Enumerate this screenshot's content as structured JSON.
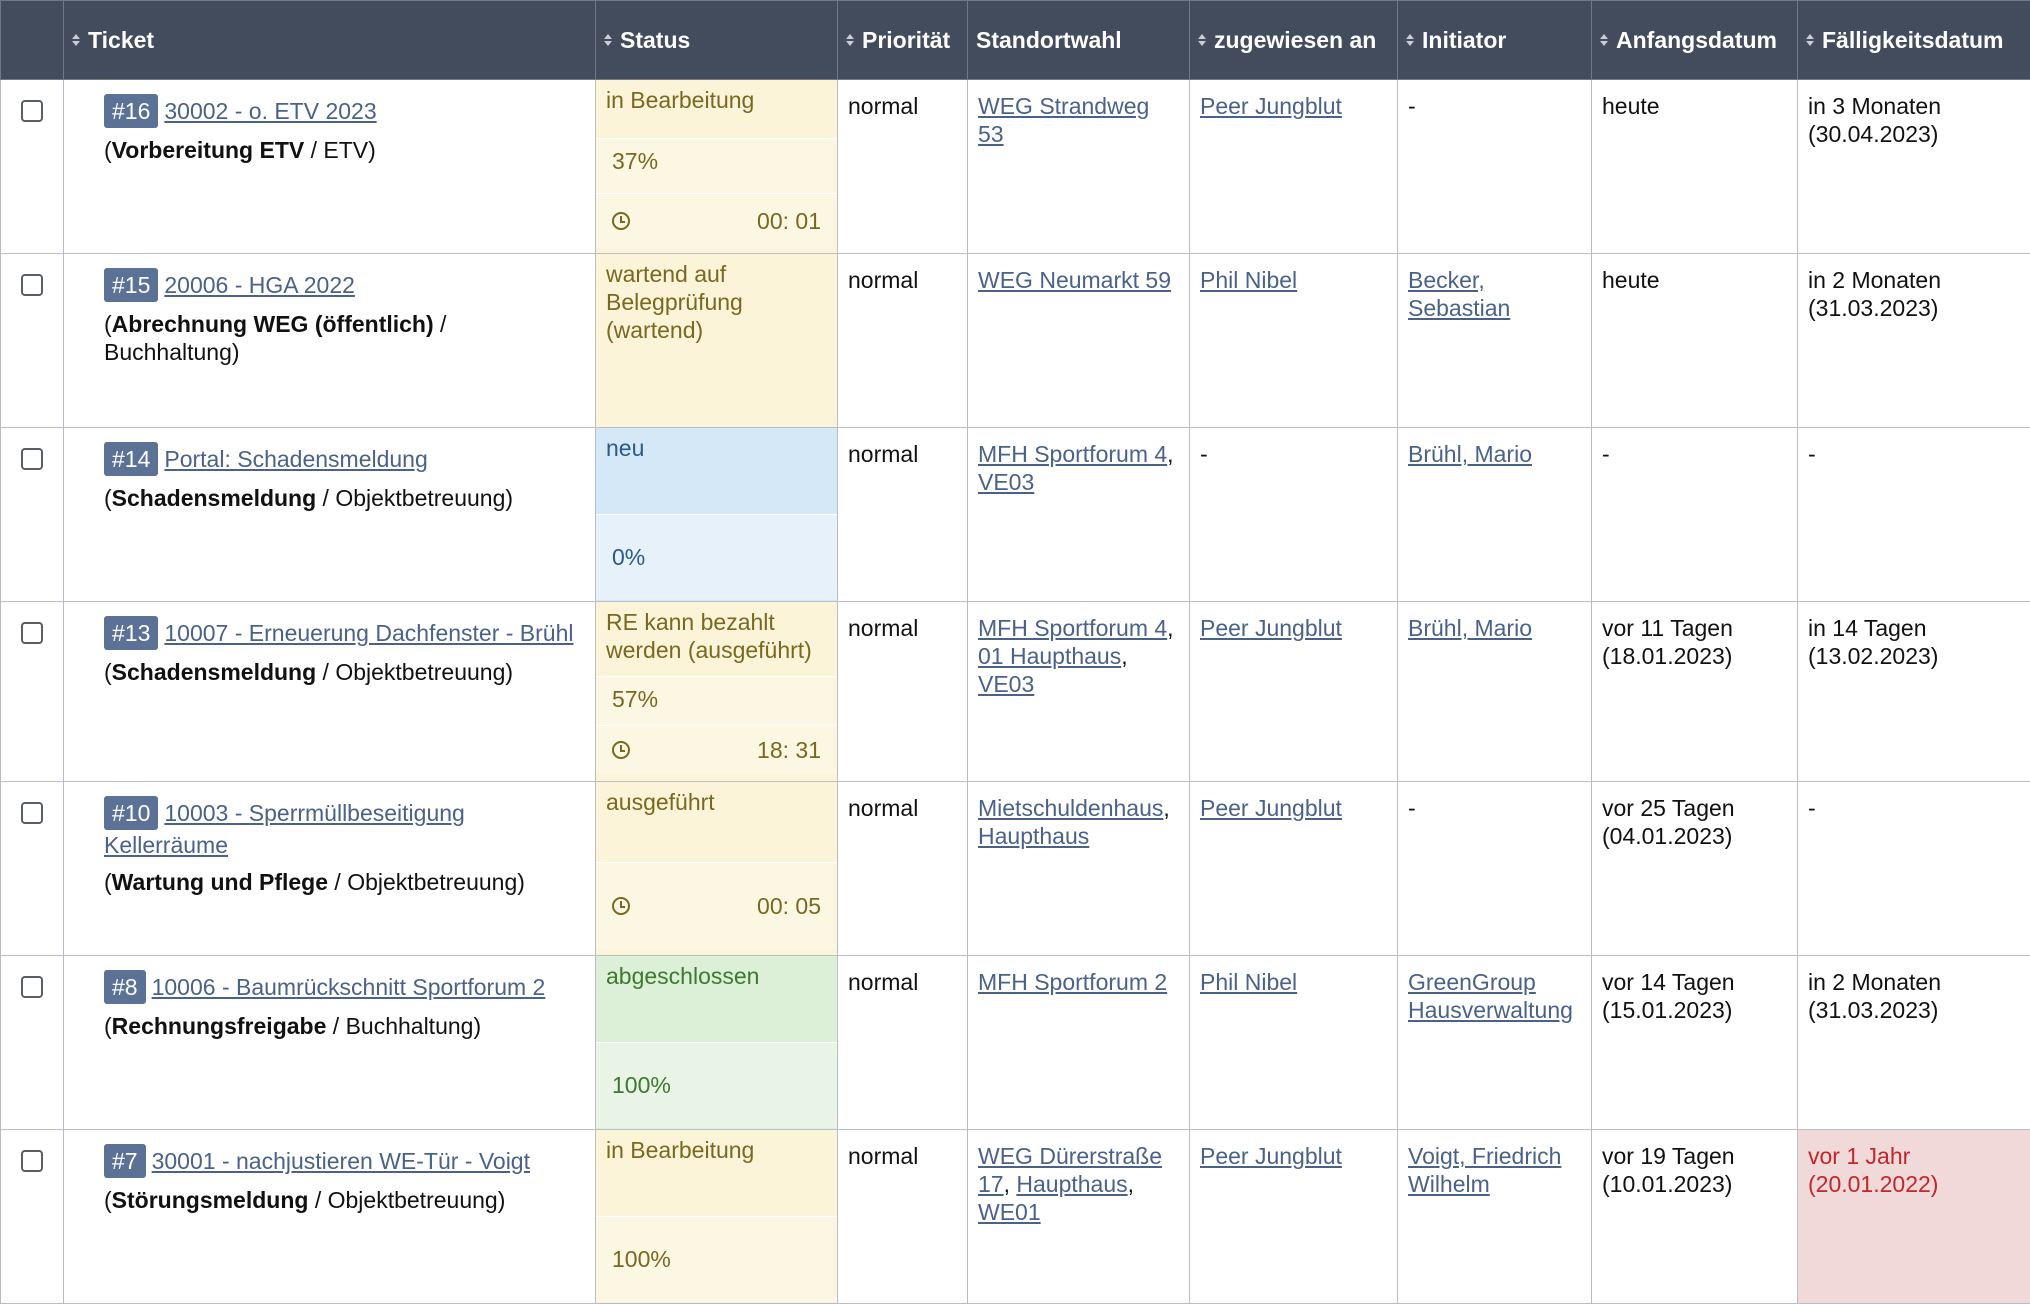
{
  "headers": {
    "ticket": "Ticket",
    "status": "Status",
    "priority": "Priorität",
    "location": "Standortwahl",
    "assigned": "zugewiesen an",
    "initiator": "Initiator",
    "start": "Anfangsdatum",
    "due": "Fälligkeitsdatum"
  },
  "rows": [
    {
      "id": "#16",
      "title": "30002 - o. ETV 2023",
      "category": "Vorbereitung ETV",
      "group": "ETV",
      "status": "in Bearbeitung",
      "progress": "37%",
      "time": "00: 01",
      "priority": "normal",
      "location": "WEG Strandweg 53",
      "assigned": "Peer Jungblut",
      "initiator": "-",
      "start": "heute",
      "due": "in 3 Monaten (30.04.2023)"
    },
    {
      "id": "#15",
      "title": "20006 - HGA 2022",
      "category": "Abrechnung WEG (öffentlich)",
      "group": "Buchhaltung",
      "status": "wartend auf Belegprüfung (wartend)",
      "priority": "normal",
      "location": "WEG Neumarkt 59",
      "assigned": "Phil Nibel",
      "initiator": "Becker, Sebastian",
      "start": "heute",
      "due": "in 2 Monaten (31.03.2023)"
    },
    {
      "id": "#14",
      "title": "Portal: Schadensmeldung",
      "category": "Schadensmeldung",
      "group": "Objektbetreuung",
      "status": "neu",
      "progress": "0%",
      "priority": "normal",
      "location_a": "MFH Sportforum 4",
      "location_b": "VE03",
      "assigned": "-",
      "initiator": "Brühl, Mario",
      "start": "-",
      "due": "-"
    },
    {
      "id": "#13",
      "title": "10007 - Erneuerung Dachfenster - Brühl",
      "category": "Schadensmeldung",
      "group": "Objektbetreuung",
      "status": "RE kann bezahlt werden (ausgeführt)",
      "progress": "57%",
      "time": "18: 31",
      "priority": "normal",
      "location_a": "MFH Sportforum 4",
      "location_b": "01 Haupthaus",
      "location_c": "VE03",
      "assigned": "Peer Jungblut",
      "initiator": "Brühl, Mario",
      "start": "vor 11 Tagen (18.01.2023)",
      "due": "in 14 Tagen (13.02.2023)"
    },
    {
      "id": "#10",
      "title": "10003 - Sperrmüllbeseitigung Kellerräume",
      "category": "Wartung und Pflege",
      "group": "Objektbetreuung",
      "status": "ausgeführt",
      "time": "00: 05",
      "priority": "normal",
      "location_a": "Mietschuldenhaus",
      "location_b": "Haupthaus",
      "assigned": "Peer Jungblut",
      "initiator": "-",
      "start": "vor 25 Tagen (04.01.2023)",
      "due": "-"
    },
    {
      "id": "#8",
      "title": "10006 - Baumrückschnitt Sportforum 2",
      "category": "Rechnungsfreigabe",
      "group": "Buchhaltung",
      "status": "abgeschlossen",
      "progress": "100%",
      "priority": "normal",
      "location": "MFH Sportforum 2",
      "assigned": "Phil Nibel",
      "initiator": "GreenGroup Hausverwaltung",
      "start": "vor 14 Tagen (15.01.2023)",
      "due": "in 2 Monaten (31.03.2023)"
    },
    {
      "id": "#7",
      "title": "30001 - nachjustieren WE-Tür - Voigt",
      "category": "Störungsmeldung",
      "group": "Objektbetreuung",
      "status": "in Bearbeitung",
      "progress": "100%",
      "priority": "normal",
      "location_a": "WEG Dürerstraße 17",
      "location_b": "Haupthaus",
      "location_c": "WE01",
      "assigned": "Peer Jungblut",
      "initiator": "Voigt, Friedrich Wilhelm",
      "start": "vor 19 Tagen (10.01.2023)",
      "due": "vor 1 Jahr (20.01.2022)"
    }
  ]
}
